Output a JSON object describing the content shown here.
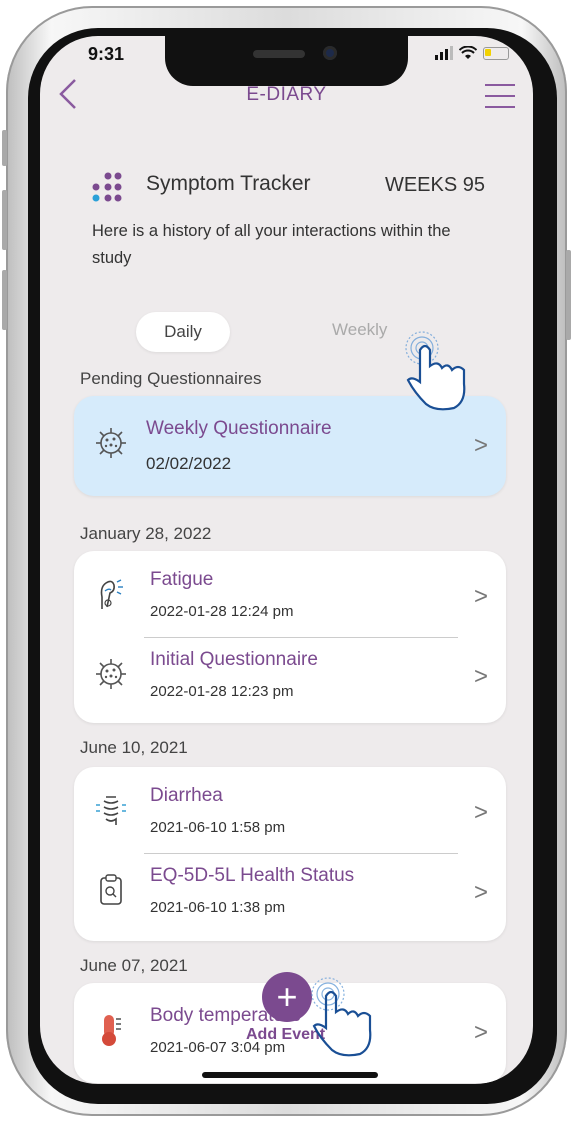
{
  "status_bar": {
    "time": "9:31"
  },
  "header": {
    "title": "E-DIARY",
    "back_icon": "chevron-left-icon",
    "menu_icon": "hamburger-icon"
  },
  "tracker": {
    "title": "Symptom Tracker",
    "weeks": "WEEKS 95",
    "description": "Here is a history of all your interactions within the study"
  },
  "tabs": {
    "daily": "Daily",
    "weekly": "Weekly"
  },
  "pending": {
    "label": "Pending Questionnaires",
    "item": {
      "name": "Weekly Questionnaire",
      "date": "02/02/2022",
      "icon": "virus-icon"
    }
  },
  "groups": [
    {
      "date": "January 28, 2022",
      "items": [
        {
          "name": "Fatigue",
          "date": "2022-01-28 12:24 pm",
          "icon": "fatigue-icon"
        },
        {
          "name": "Initial Questionnaire",
          "date": "2022-01-28 12:23 pm",
          "icon": "virus-icon"
        }
      ]
    },
    {
      "date": "June 10, 2021",
      "items": [
        {
          "name": "Diarrhea",
          "date": "2021-06-10 1:58 pm",
          "icon": "intestine-icon"
        },
        {
          "name": "EQ-5D-5L Health Status",
          "date": "2021-06-10 1:38 pm",
          "icon": "clipboard-icon"
        }
      ]
    },
    {
      "date": "June 07, 2021",
      "items": [
        {
          "name": "Body temperature",
          "date": "2021-06-07 3:04 pm",
          "icon": "thermometer-icon"
        }
      ]
    }
  ],
  "fab": {
    "symbol": "+",
    "label": "Add Event"
  },
  "colors": {
    "accent": "#7b4a8f",
    "pending_bg": "#d6ebfb",
    "screen_bg": "#eeebec",
    "hand_stroke": "#1a4f95"
  }
}
